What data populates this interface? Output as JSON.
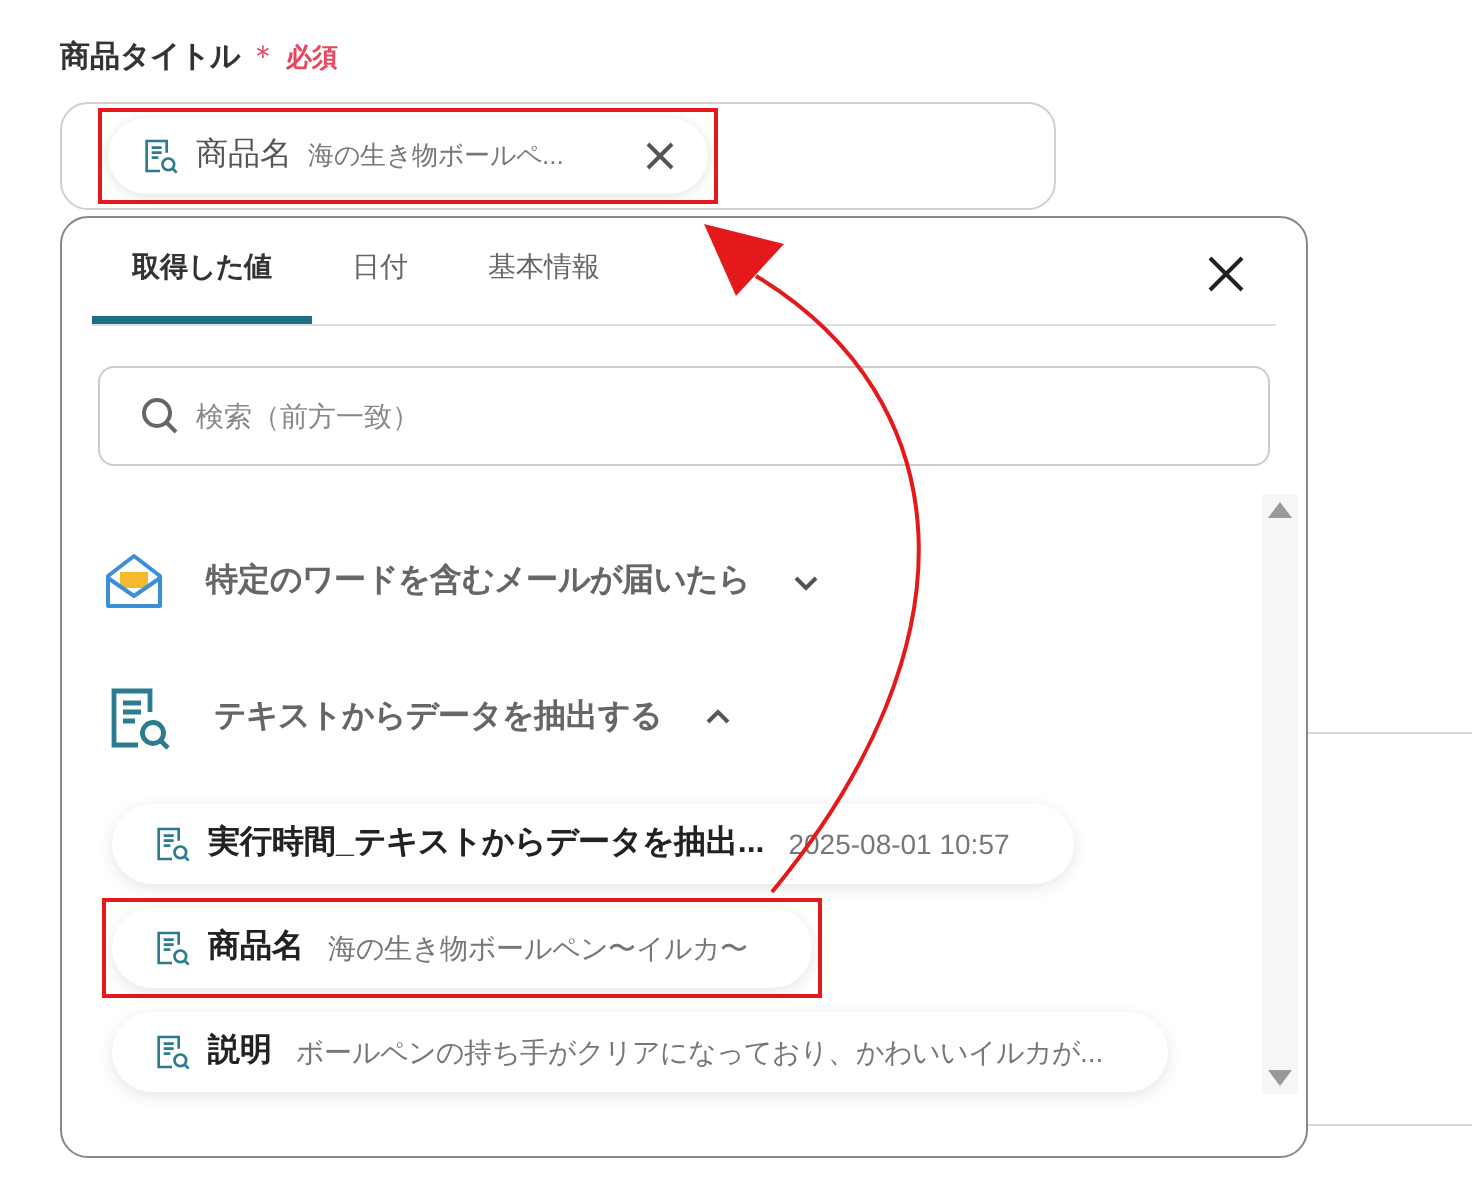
{
  "field": {
    "label": "商品タイトル",
    "required_mark": "＊",
    "required_text": "必須",
    "chip": {
      "name": "商品名",
      "value": "海の生き物ボールペ...",
      "highlighted": true
    }
  },
  "popup": {
    "tabs": [
      {
        "label": "取得した値",
        "selected": true
      },
      {
        "label": "日付",
        "selected": false
      },
      {
        "label": "基本情報",
        "selected": false
      }
    ],
    "search": {
      "placeholder": "検索（前方一致）"
    },
    "groups": [
      {
        "kind": "mail",
        "title": "特定のワードを含むメールが届いたら",
        "expanded": false
      },
      {
        "kind": "extract",
        "title": "テキストからデータを抽出する",
        "expanded": true,
        "items": [
          {
            "name": "実行時間_テキストからデータを抽出...",
            "value": "2025-08-01 10:57",
            "highlighted": false
          },
          {
            "name": "商品名",
            "value": "海の生き物ボールペン〜イルカ〜",
            "highlighted": true
          },
          {
            "name": "説明",
            "value": "ボールペンの持ち手がクリアになっており、かわいいイルカが...",
            "highlighted": false
          }
        ]
      }
    ]
  },
  "annotation": {
    "arrow": true
  }
}
